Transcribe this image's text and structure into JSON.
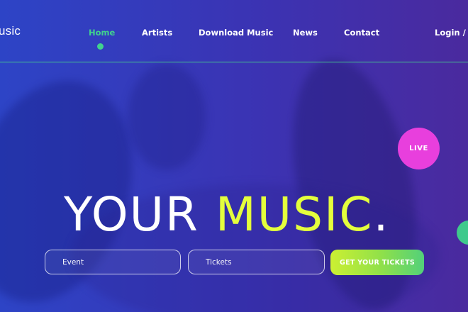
{
  "colors": {
    "accent_green": "#41d28e",
    "headline_yellow": "#e4ff3c",
    "live_pink": "#e83fdd",
    "background_blue": "#3b33b3"
  },
  "header": {
    "logo": "usic",
    "nav": [
      "Home",
      "Artists",
      "Download Music",
      "News",
      "Contact"
    ],
    "active_nav": "Home",
    "login_label": "Login / l"
  },
  "hero": {
    "headline_part1": "YOUR",
    "headline_part2": "MUSIC",
    "headline_part3": ".",
    "live_badge": "LIVE"
  },
  "form": {
    "event_placeholder": "Event",
    "tickets_placeholder": "Tickets",
    "cta_label": "GET YOUR TICKETS"
  }
}
